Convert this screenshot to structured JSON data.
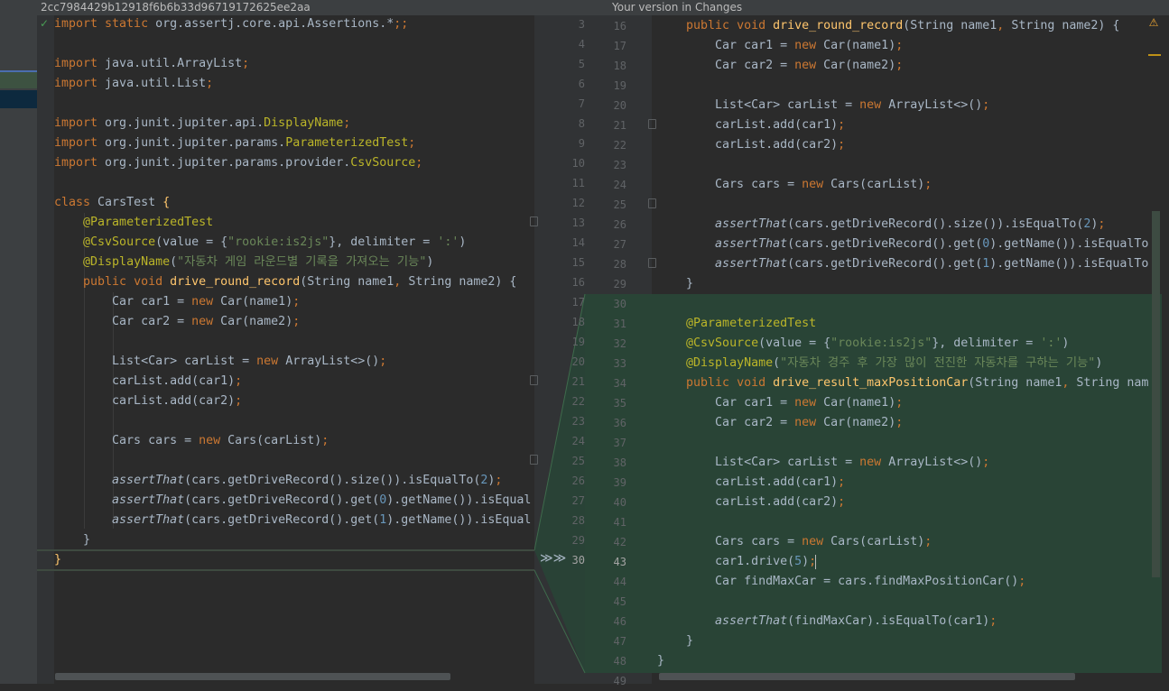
{
  "left_pane": {
    "header": "2cc7984429b12918f6b6b33d96719172625ee2aa",
    "lines": [
      [
        [
          "kw",
          "import static "
        ],
        [
          "",
          "org.assertj.core.api.Assertions.*"
        ],
        [
          "kw",
          ";;"
        ]
      ],
      [],
      [
        [
          "kw",
          "import "
        ],
        [
          "",
          "java.util.ArrayList"
        ],
        [
          "kw",
          ";"
        ]
      ],
      [
        [
          "kw",
          "import "
        ],
        [
          "",
          "java.util.List"
        ],
        [
          "kw",
          ";"
        ]
      ],
      [],
      [
        [
          "kw",
          "import "
        ],
        [
          "",
          "org.junit.jupiter.api."
        ],
        [
          "an",
          "DisplayName"
        ],
        [
          "kw",
          ";"
        ]
      ],
      [
        [
          "kw",
          "import "
        ],
        [
          "",
          "org.junit.jupiter.params."
        ],
        [
          "an",
          "ParameterizedTest"
        ],
        [
          "kw",
          ";"
        ]
      ],
      [
        [
          "kw",
          "import "
        ],
        [
          "",
          "org.junit.jupiter.params.provider."
        ],
        [
          "an",
          "CsvSource"
        ],
        [
          "kw",
          ";"
        ]
      ],
      [],
      [
        [
          "kw",
          "class "
        ],
        [
          "",
          "CarsTest "
        ],
        [
          "fn",
          "{"
        ]
      ],
      [
        [
          "",
          "    "
        ],
        [
          "an",
          "@ParameterizedTest"
        ]
      ],
      [
        [
          "",
          "    "
        ],
        [
          "an",
          "@CsvSource"
        ],
        [
          "",
          "(value = {"
        ],
        [
          "st",
          "\"rookie:is2js\""
        ],
        [
          "",
          "}, delimiter = "
        ],
        [
          "st",
          "':'"
        ],
        [
          "",
          ")"
        ]
      ],
      [
        [
          "",
          "    "
        ],
        [
          "an",
          "@DisplayName"
        ],
        [
          "",
          "("
        ],
        [
          "st",
          "\"자동차 게임 라운드별 기록을 가져오는 기능\""
        ],
        [
          "",
          ")"
        ]
      ],
      [
        [
          "",
          "    "
        ],
        [
          "kw",
          "public void "
        ],
        [
          "fn",
          "drive_round_record"
        ],
        [
          "",
          "(String name1"
        ],
        [
          "kw",
          ", "
        ],
        [
          "",
          "String name2) {"
        ]
      ],
      [
        [
          "",
          "        Car car1 = "
        ],
        [
          "kw",
          "new "
        ],
        [
          "",
          "Car(name1)"
        ],
        [
          "kw",
          ";"
        ]
      ],
      [
        [
          "",
          "        Car car2 = "
        ],
        [
          "kw",
          "new "
        ],
        [
          "",
          "Car(name2)"
        ],
        [
          "kw",
          ";"
        ]
      ],
      [],
      [
        [
          "",
          "        List<Car> carList = "
        ],
        [
          "kw",
          "new "
        ],
        [
          "",
          "ArrayList<>()"
        ],
        [
          "kw",
          ";"
        ]
      ],
      [
        [
          "",
          "        carList.add(car1)"
        ],
        [
          "kw",
          ";"
        ]
      ],
      [
        [
          "",
          "        carList.add(car2)"
        ],
        [
          "kw",
          ";"
        ]
      ],
      [],
      [
        [
          "",
          "        Cars cars = "
        ],
        [
          "kw",
          "new "
        ],
        [
          "",
          "Cars(carList)"
        ],
        [
          "kw",
          ";"
        ]
      ],
      [],
      [
        [
          "",
          "        "
        ],
        [
          "it",
          "assertThat"
        ],
        [
          "",
          "(cars.getDriveRecord().size()).isEqualTo("
        ],
        [
          "nu",
          "2"
        ],
        [
          "",
          ")"
        ],
        [
          "kw",
          ";"
        ]
      ],
      [
        [
          "",
          "        "
        ],
        [
          "it",
          "assertThat"
        ],
        [
          "",
          "(cars.getDriveRecord().get("
        ],
        [
          "nu",
          "0"
        ],
        [
          "",
          ").getName()).isEqual"
        ]
      ],
      [
        [
          "",
          "        "
        ],
        [
          "it",
          "assertThat"
        ],
        [
          "",
          "(cars.getDriveRecord().get("
        ],
        [
          "nu",
          "1"
        ],
        [
          "",
          ").getName()).isEqual"
        ]
      ],
      [
        [
          "",
          "    }"
        ]
      ],
      [
        [
          "fn",
          "}"
        ]
      ]
    ]
  },
  "middle_line_numbers": [
    "3",
    "4",
    "5",
    "6",
    "7",
    "8",
    "9",
    "10",
    "11",
    "12",
    "13",
    "14",
    "15",
    "16",
    "17",
    "18",
    "19",
    "20",
    "21",
    "22",
    "23",
    "24",
    "25",
    "26",
    "27",
    "28",
    "29",
    "30"
  ],
  "right_pane": {
    "header": "Your version in Changes",
    "line_numbers": [
      "16",
      "17",
      "18",
      "19",
      "20",
      "21",
      "22",
      "23",
      "24",
      "25",
      "26",
      "27",
      "28",
      "29",
      "30",
      "31",
      "32",
      "33",
      "34",
      "35",
      "36",
      "37",
      "38",
      "39",
      "40",
      "41",
      "42",
      "43",
      "44",
      "45",
      "46",
      "47",
      "48",
      "49"
    ],
    "lines": [
      [
        [
          "",
          "    "
        ],
        [
          "kw",
          "public void "
        ],
        [
          "fn",
          "drive_round_record"
        ],
        [
          "",
          "(String name1"
        ],
        [
          "kw",
          ", "
        ],
        [
          "",
          "String name2) {"
        ]
      ],
      [
        [
          "",
          "        Car car1 = "
        ],
        [
          "kw",
          "new "
        ],
        [
          "",
          "Car(name1)"
        ],
        [
          "kw",
          ";"
        ]
      ],
      [
        [
          "",
          "        Car car2 = "
        ],
        [
          "kw",
          "new "
        ],
        [
          "",
          "Car(name2)"
        ],
        [
          "kw",
          ";"
        ]
      ],
      [],
      [
        [
          "",
          "        List<Car> carList = "
        ],
        [
          "kw",
          "new "
        ],
        [
          "",
          "ArrayList<>()"
        ],
        [
          "kw",
          ";"
        ]
      ],
      [
        [
          "",
          "        carList.add(car1)"
        ],
        [
          "kw",
          ";"
        ]
      ],
      [
        [
          "",
          "        carList.add(car2)"
        ],
        [
          "kw",
          ";"
        ]
      ],
      [],
      [
        [
          "",
          "        Cars cars = "
        ],
        [
          "kw",
          "new "
        ],
        [
          "",
          "Cars(carList)"
        ],
        [
          "kw",
          ";"
        ]
      ],
      [],
      [
        [
          "",
          "        "
        ],
        [
          "it",
          "assertThat"
        ],
        [
          "",
          "(cars.getDriveRecord().size()).isEqualTo("
        ],
        [
          "nu",
          "2"
        ],
        [
          "",
          ")"
        ],
        [
          "kw",
          ";"
        ]
      ],
      [
        [
          "",
          "        "
        ],
        [
          "it",
          "assertThat"
        ],
        [
          "",
          "(cars.getDriveRecord().get("
        ],
        [
          "nu",
          "0"
        ],
        [
          "",
          ").getName()).isEqualTo(n"
        ]
      ],
      [
        [
          "",
          "        "
        ],
        [
          "it",
          "assertThat"
        ],
        [
          "",
          "(cars.getDriveRecord().get("
        ],
        [
          "nu",
          "1"
        ],
        [
          "",
          ").getName()).isEqualTo(n"
        ]
      ],
      [
        [
          "",
          "    }"
        ]
      ],
      [],
      [
        [
          "",
          "    "
        ],
        [
          "an",
          "@ParameterizedTest"
        ]
      ],
      [
        [
          "",
          "    "
        ],
        [
          "an",
          "@CsvSource"
        ],
        [
          "",
          "(value = {"
        ],
        [
          "st",
          "\"rookie:is2js\""
        ],
        [
          "",
          "}, delimiter = "
        ],
        [
          "st",
          "':'"
        ],
        [
          "",
          ")"
        ]
      ],
      [
        [
          "",
          "    "
        ],
        [
          "an",
          "@DisplayName"
        ],
        [
          "",
          "("
        ],
        [
          "st",
          "\"자동차 경주 후 가장 많이 전진한 자동차를 구하는 기능\""
        ],
        [
          "",
          ")"
        ]
      ],
      [
        [
          "",
          "    "
        ],
        [
          "kw",
          "public void "
        ],
        [
          "fn",
          "drive_result_maxPositionCar"
        ],
        [
          "",
          "(String name1"
        ],
        [
          "kw",
          ", "
        ],
        [
          "",
          "String nam"
        ]
      ],
      [
        [
          "",
          "        Car car1 = "
        ],
        [
          "kw",
          "new "
        ],
        [
          "",
          "Car(name1)"
        ],
        [
          "kw",
          ";"
        ]
      ],
      [
        [
          "",
          "        Car car2 = "
        ],
        [
          "kw",
          "new "
        ],
        [
          "",
          "Car(name2)"
        ],
        [
          "kw",
          ";"
        ]
      ],
      [],
      [
        [
          "",
          "        List<Car> carList = "
        ],
        [
          "kw",
          "new "
        ],
        [
          "",
          "ArrayList<>()"
        ],
        [
          "kw",
          ";"
        ]
      ],
      [
        [
          "",
          "        carList.add(car1)"
        ],
        [
          "kw",
          ";"
        ]
      ],
      [
        [
          "",
          "        carList.add(car2)"
        ],
        [
          "kw",
          ";"
        ]
      ],
      [],
      [
        [
          "",
          "        Cars cars = "
        ],
        [
          "kw",
          "new "
        ],
        [
          "",
          "Cars(carList)"
        ],
        [
          "kw",
          ";"
        ]
      ],
      [
        [
          "",
          "        car1.drive("
        ],
        [
          "nu",
          "5"
        ],
        [
          "",
          ")"
        ],
        [
          "kw",
          ";"
        ]
      ],
      [
        [
          "",
          "        Car findMaxCar = cars.findMaxPositionCar()"
        ],
        [
          "kw",
          ";"
        ]
      ],
      [],
      [
        [
          "",
          "        "
        ],
        [
          "it",
          "assertThat"
        ],
        [
          "",
          "(findMaxCar).isEqualTo(car1)"
        ],
        [
          "kw",
          ";"
        ]
      ],
      [
        [
          "",
          "    }"
        ]
      ],
      [
        [
          "",
          "}"
        ]
      ],
      []
    ]
  },
  "icons": {
    "check": "✓",
    "warning": "⚠",
    "arrows": "≫≫"
  }
}
